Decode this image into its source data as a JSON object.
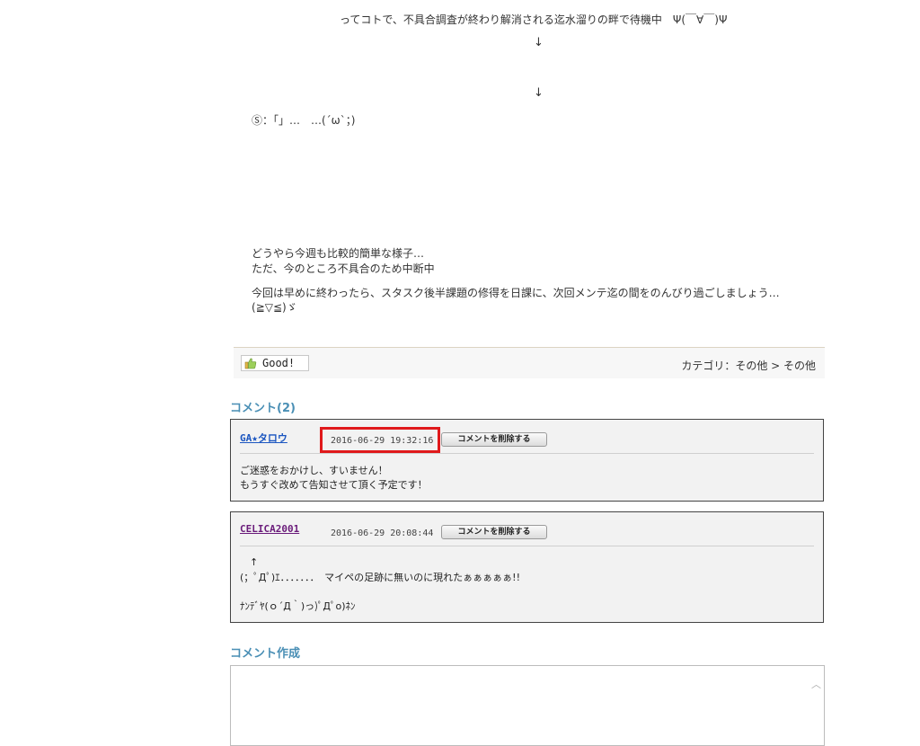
{
  "post": {
    "line_waiting": "ってコトで、不具合調査が終わり解消される迄水溜りの畔で待機中　Ψ(￣∀￣)Ψ",
    "arrow": "↓",
    "dialog": "Ⓢ：「」…　…(´ω`；)",
    "para1": [
      "どうやら今週も比較的簡単な様子…",
      "ただ、今のところ不具合のため中断中"
    ],
    "para2": [
      "今回は早めに終わったら、スタスク後半課題の修得を日課に、次回メンテ迄の間をのんびり過ごしましょう…",
      "(≧▽≦)ゞ"
    ]
  },
  "feedback": {
    "good_label": "Good!",
    "category": "カテゴリ：その他 > その他"
  },
  "comments_section": {
    "title": "コメント(2)",
    "items": [
      {
        "author": "GA★タロウ",
        "date": "2016-06-29 19:32:16",
        "delete_label": "コメントを削除する",
        "body": [
          "ご迷惑をおかけし、すいません！",
          "もうすぐ改めて告知させて頂く予定です！"
        ]
      },
      {
        "author": "CELICA2001",
        "date": "2016-06-29 20:08:44",
        "delete_label": "コメントを削除する",
        "body": [
          "　↑",
          "(；ﾟДﾟ)ｴ．．．．．．．　マイペの足跡に無いのに現れたぁぁぁぁぁ!!",
          "",
          "ﾅﾝﾃﾞﾔ(ｏ´Д｀)っ)ﾟДﾟo)ﾈﾝ"
        ]
      }
    ]
  },
  "compose": {
    "title": "コメント作成",
    "textarea_value": ""
  },
  "colors": {
    "accent": "#4a8fb5",
    "highlight": "#e0191b",
    "author_link": "#1a55c0",
    "author_visited": "#6a1b7a"
  },
  "icons": {
    "thumb": "thumbs-up-icon",
    "scroll": "scroll-up-arrow-icon"
  }
}
